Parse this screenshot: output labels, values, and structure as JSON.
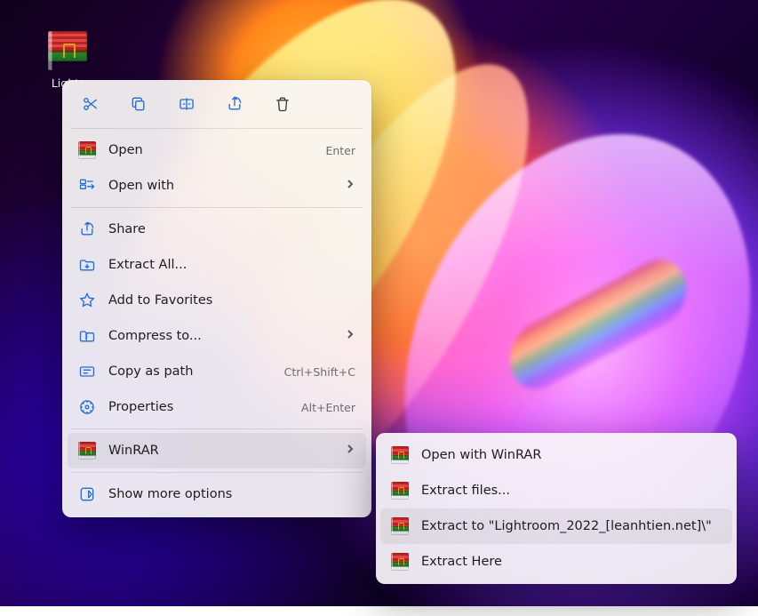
{
  "desktop": {
    "icon_label": "Lightr"
  },
  "menu": {
    "top_icons": [
      "cut",
      "copy",
      "rename",
      "share",
      "delete"
    ],
    "items": [
      {
        "icon": "winrar",
        "label": "Open",
        "accel": "Enter",
        "submenu": false
      },
      {
        "icon": "openwith",
        "label": "Open with",
        "accel": "",
        "submenu": true
      },
      {
        "icon": "share2",
        "label": "Share",
        "accel": "",
        "submenu": false
      },
      {
        "icon": "extract",
        "label": "Extract All...",
        "accel": "",
        "submenu": false
      },
      {
        "icon": "star",
        "label": "Add to Favorites",
        "accel": "",
        "submenu": false
      },
      {
        "icon": "compress",
        "label": "Compress to...",
        "accel": "",
        "submenu": true
      },
      {
        "icon": "copypath",
        "label": "Copy as path",
        "accel": "Ctrl+Shift+C",
        "submenu": false
      },
      {
        "icon": "props",
        "label": "Properties",
        "accel": "Alt+Enter",
        "submenu": false
      }
    ],
    "winrar_item": {
      "label": "WinRAR",
      "submenu": true,
      "highlighted": true
    },
    "more_options": {
      "label": "Show more options"
    }
  },
  "submenu": {
    "items": [
      {
        "label": "Open with WinRAR",
        "highlighted": false
      },
      {
        "label": "Extract files...",
        "highlighted": false
      },
      {
        "label": "Extract to \"Lightroom_2022_[leanhtien.net]\\\"",
        "highlighted": true
      },
      {
        "label": "Extract Here",
        "highlighted": false
      }
    ]
  }
}
